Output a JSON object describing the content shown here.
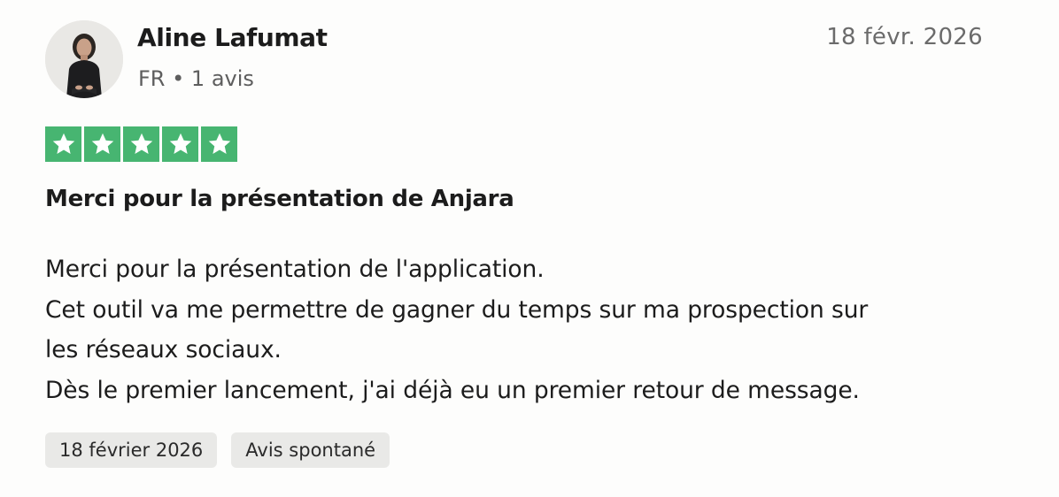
{
  "reviewer": {
    "name": "Aline Lafumat",
    "country": "FR",
    "review_count": "1 avis",
    "separator": "•"
  },
  "review": {
    "date_short": "18 févr. 2026",
    "rating": 5,
    "rating_max": 5,
    "star_color": "#47b571",
    "title": "Merci pour la présentation de Anjara",
    "body_lines": [
      "Merci pour la présentation de l'application.",
      "Cet outil va me permettre de gagner du temps sur ma prospection sur",
      "les réseaux sociaux.",
      "Dès le premier lancement, j'ai déjà eu un premier retour de message."
    ],
    "tags": [
      "18 février 2026",
      "Avis spontané"
    ]
  }
}
